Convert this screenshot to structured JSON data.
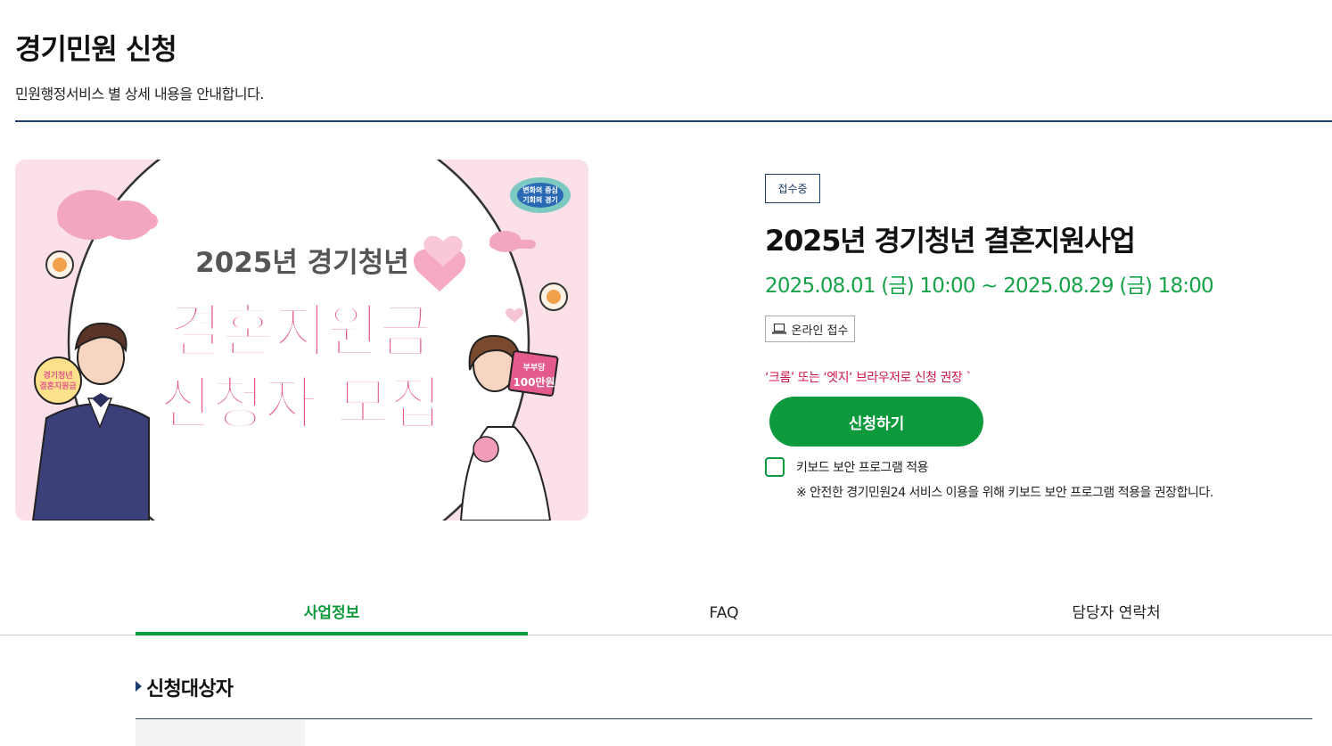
{
  "page": {
    "title": "경기민원 신청",
    "subtitle": "민원행정서비스 별 상세 내용을 안내합니다."
  },
  "banner": {
    "line1": "2025년 경기청년",
    "line2": "결혼지원금",
    "line3": "신청자 모집",
    "sign_left_1": "경기청년",
    "sign_left_2": "결혼지원금",
    "sign_right_1": "부부당",
    "sign_right_2": "100만원",
    "logo_1": "변화의 중심",
    "logo_2": "기회의 경기"
  },
  "service": {
    "status": "접수중",
    "title": "2025년 경기청년 결혼지원사업",
    "period": "2025.08.01 (금) 10:00 ~ 2025.08.29 (금) 18:00",
    "method": "온라인 접수",
    "method_icon": "laptop-icon",
    "browser_notice": "‘크롬’ 또는 ‘엣지‘ 브라우저로 신청 권장 `",
    "apply_label": "신청하기",
    "keyboard_security_label": "키보드 보안 프로그램 적용",
    "keyboard_security_checked": false,
    "keyboard_security_note": "※ 안전한 경기민원24 서비스 이용을 위해 키보드 보안 프로그램 적용을 권장합니다."
  },
  "tabs": [
    {
      "label": "사업정보",
      "active": true
    },
    {
      "label": "FAQ",
      "active": false
    },
    {
      "label": "담당자 연락처",
      "active": false
    }
  ],
  "section": {
    "title": "신청대상자"
  },
  "colors": {
    "accent_green": "#0d9a3c",
    "period_green": "#17a24a",
    "navy": "#1d3f6e",
    "notice_red": "#d1184b",
    "banner_pink": "#e45a8c"
  }
}
